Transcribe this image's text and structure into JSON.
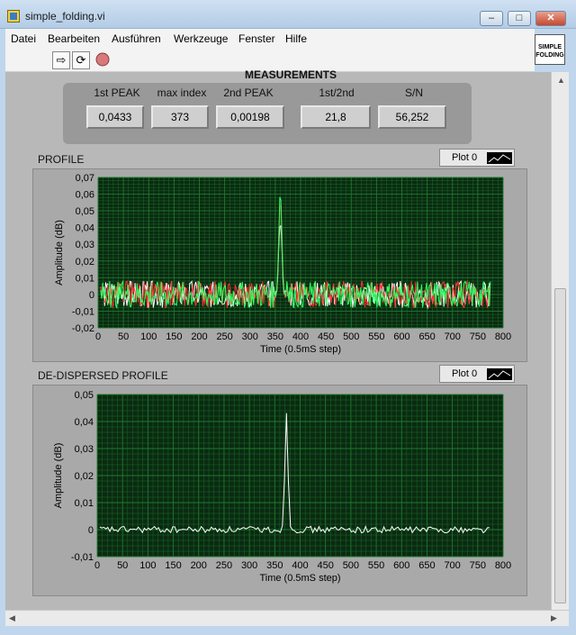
{
  "window": {
    "title": "simple_folding.vi"
  },
  "menu": [
    "Datei",
    "Bearbeiten",
    "Ausführen",
    "Werkzeuge",
    "Fenster",
    "Hilfe"
  ],
  "vi_icon_text": [
    "SIMPLE",
    "FOLDING"
  ],
  "measurements": {
    "title": "MEASUREMENTS",
    "items": [
      {
        "label": "1st PEAK",
        "value": "0,0433"
      },
      {
        "label": "max index",
        "value": "373"
      },
      {
        "label": "2nd PEAK",
        "value": "0,00198"
      },
      {
        "label": "1st/2nd",
        "value": "21,8"
      },
      {
        "label": "S/N",
        "value": "56,252"
      }
    ]
  },
  "profile": {
    "title": "PROFILE",
    "legend": "Plot 0",
    "chart_data": {
      "type": "line",
      "xlabel": "Time (0.5mS step)",
      "ylabel": "Amplitude (dB)",
      "xlim": [
        0,
        800
      ],
      "ylim": [
        -0.02,
        0.07
      ],
      "x_ticks": [
        "0",
        "50",
        "100",
        "150",
        "200",
        "250",
        "300",
        "350",
        "400",
        "450",
        "500",
        "550",
        "600",
        "650",
        "700",
        "750",
        "800"
      ],
      "y_ticks": [
        "-0,02",
        "-0,01",
        "0",
        "0,01",
        "0,02",
        "0,03",
        "0,04",
        "0,05",
        "0,06",
        "0,07"
      ],
      "colors": {
        "bg": "#0a2a12",
        "grid": "#1f7a2c",
        "series": [
          "#ffffff",
          "#ff3030",
          "#30ff60"
        ]
      },
      "peak": {
        "x": 360,
        "heights": [
          0.045,
          0.058,
          0.061
        ]
      },
      "noise_amplitude": 0.008,
      "x_range": [
        5,
        775
      ]
    }
  },
  "dedispersed": {
    "title": "DE-DISPERSED PROFILE",
    "legend": "Plot 0",
    "chart_data": {
      "type": "line",
      "xlabel": "Time (0.5mS step)",
      "ylabel": "Amplitude (dB)",
      "xlim": [
        0,
        800
      ],
      "ylim": [
        -0.01,
        0.05
      ],
      "x_ticks": [
        "0",
        "50",
        "100",
        "150",
        "200",
        "250",
        "300",
        "350",
        "400",
        "450",
        "500",
        "550",
        "600",
        "650",
        "700",
        "750",
        "800"
      ],
      "y_ticks": [
        "-0,01",
        "0",
        "0,01",
        "0,02",
        "0,03",
        "0,04",
        "0,05"
      ],
      "colors": {
        "bg": "#0a2a12",
        "grid": "#1f7a2c",
        "series": [
          "#ffffff"
        ]
      },
      "peak": {
        "x": 373,
        "heights": [
          0.0433
        ]
      },
      "noise_amplitude": 0.0012,
      "x_range": [
        5,
        775
      ]
    }
  }
}
